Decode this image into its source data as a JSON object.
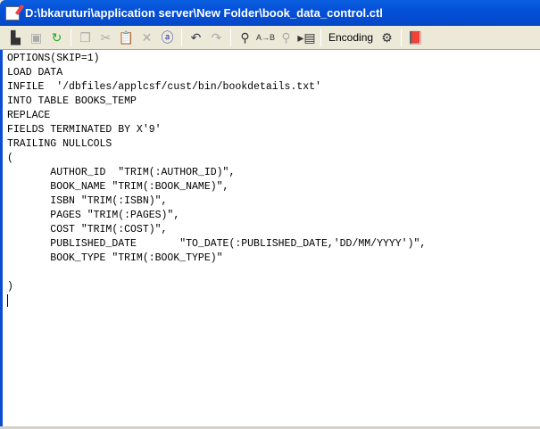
{
  "window": {
    "title": "D:\\bkaruturi\\application server\\New Folder\\book_data_control.ctl"
  },
  "toolbar": {
    "encoding_label": "Encoding"
  },
  "editor": {
    "lines": [
      "OPTIONS(SKIP=1)",
      "LOAD DATA",
      "INFILE  '/dbfiles/applcsf/cust/bin/bookdetails.txt'",
      "INTO TABLE BOOKS_TEMP",
      "REPLACE",
      "FIELDS TERMINATED BY X'9'",
      "TRAILING NULLCOLS",
      "(",
      "       AUTHOR_ID  \"TRIM(:AUTHOR_ID)\",",
      "       BOOK_NAME \"TRIM(:BOOK_NAME)\",",
      "       ISBN \"TRIM(:ISBN)\",",
      "       PAGES \"TRIM(:PAGES)\",",
      "       COST \"TRIM(:COST)\",",
      "       PUBLISHED_DATE       \"TO_DATE(:PUBLISHED_DATE,'DD/MM/YYYY')\",",
      "       BOOK_TYPE \"TRIM(:BOOK_TYPE)\"",
      "",
      ")"
    ]
  }
}
